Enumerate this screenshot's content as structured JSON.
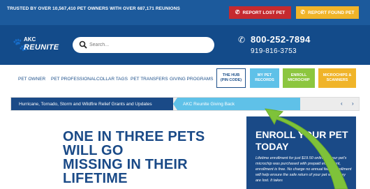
{
  "topbar": {
    "trusted_text": "TRUSTED BY OVER 10,567,410 PET OWNERS WITH OVER 687,171 REUNIONS",
    "report_lost_label": "REPORT LOST PET",
    "report_found_label": "REPORT FOUND PET",
    "lost_color": "#c52a2f",
    "found_color": "#f0b429",
    "background": "#1c5a9c"
  },
  "header": {
    "logo_line1": "AKC",
    "logo_line2": "REUNITE",
    "search_placeholder": "Search...",
    "phone_primary": "800-252-7894",
    "phone_secondary": "919-816-3753",
    "background": "#134b8a"
  },
  "nav": {
    "items": [
      "PET OWNER",
      "PET PROFESSIONAL",
      "COLLAR TAGS",
      "PET TRANSFERS",
      "GIVING PROGRAMS"
    ],
    "boxes": {
      "hub": "THE HUB (PIN CODE)",
      "records": "MY PET RECORDS",
      "enroll": "ENROLL MICROCHIP",
      "microchips": "MICROCHIPS & SCANNERS"
    }
  },
  "ticker": {
    "item1": "Hurricane, Tornado, Storm and Wildfire Relief Grants and Updates",
    "item2": "AKC Reunite Giving Back"
  },
  "hero": {
    "line1": "ONE IN THREE PETS",
    "line2": "WILL GO",
    "line3": "MISSING IN THEIR",
    "line4": "LIFETIME"
  },
  "panel": {
    "title_line1": "ENROLL YOUR PET",
    "title_line2": "TODAY",
    "text": "Lifetime enrollment for just $19.50 online. If your pet's microchip was purchased with prepaid enrollment, enrollment is free. No charge no annual fees. Enrollment will help ensure the safe return of your pet when they are lost. It takes"
  },
  "icons": {
    "paw": "paw-icon",
    "search": "search-icon",
    "phone": "phone-icon",
    "alert": "megaphone-icon",
    "arrow": "green-arrow-annotation"
  },
  "annotation_color": "#7ec23a"
}
